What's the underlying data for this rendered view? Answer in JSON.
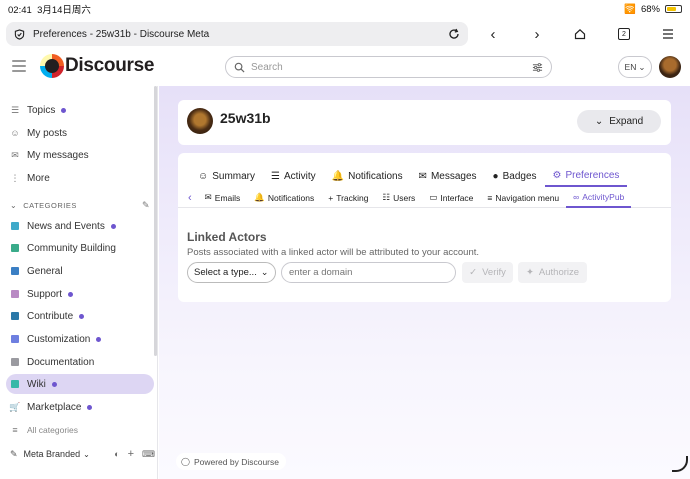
{
  "status": {
    "time": "02:41",
    "date": "3月14日周六",
    "battery": "68%",
    "battery_level": 0.68
  },
  "browser": {
    "tab_title": "Preferences - 25w31b - Discourse Meta",
    "tab_count": "2"
  },
  "header": {
    "logo_text": "Discourse",
    "search_placeholder": "Search",
    "lang": "EN"
  },
  "sidebar": {
    "top_items": [
      {
        "label": "Topics",
        "icon": "layers-icon",
        "dot": true
      },
      {
        "label": "My posts",
        "icon": "user-icon",
        "dot": false
      },
      {
        "label": "My messages",
        "icon": "inbox-icon",
        "dot": false
      },
      {
        "label": "More",
        "icon": "more-icon",
        "dot": false
      }
    ],
    "categories_heading": "CATEGORIES",
    "categories": [
      {
        "label": "News and Events",
        "color": "#3fa9c9",
        "dot": true
      },
      {
        "label": "Community Building",
        "color": "#3aab8a",
        "dot": false
      },
      {
        "label": "General",
        "color": "#3b7fc4",
        "dot": false
      },
      {
        "label": "Support",
        "color": "#b98ac4",
        "dot": true
      },
      {
        "label": "Contribute",
        "color": "#2a78a8",
        "dot": true
      },
      {
        "label": "Customization",
        "color": "#6e7fe0",
        "dot": true
      },
      {
        "label": "Documentation",
        "color": "#9a9aa0",
        "dot": false
      },
      {
        "label": "Wiki",
        "color": "#36b8a8",
        "dot": true,
        "active": true
      },
      {
        "label": "Marketplace",
        "color": "#555555",
        "dot": true
      }
    ],
    "all_categories": "All categories",
    "theme_selector": "Meta Branded"
  },
  "profile": {
    "username": "25w31b",
    "expand_label": "Expand"
  },
  "tabs": [
    {
      "label": "Summary",
      "icon": "user-icon"
    },
    {
      "label": "Activity",
      "icon": "list-icon"
    },
    {
      "label": "Notifications",
      "icon": "bell-icon"
    },
    {
      "label": "Messages",
      "icon": "envelope-icon"
    },
    {
      "label": "Badges",
      "icon": "badge-icon"
    },
    {
      "label": "Preferences",
      "icon": "gear-icon",
      "active": true
    }
  ],
  "subtabs": [
    {
      "label": "Emails",
      "icon": "envelope-icon"
    },
    {
      "label": "Notifications",
      "icon": "bell-icon"
    },
    {
      "label": "Tracking",
      "icon": "plus-icon"
    },
    {
      "label": "Users",
      "icon": "users-icon"
    },
    {
      "label": "Interface",
      "icon": "desktop-icon"
    },
    {
      "label": "Navigation menu",
      "icon": "menu-icon"
    },
    {
      "label": "ActivityPub",
      "icon": "activitypub-icon",
      "active": true
    }
  ],
  "linked_actors": {
    "title": "Linked Actors",
    "description": "Posts associated with a linked actor will be attributed to your account.",
    "select_label": "Select a type...",
    "domain_placeholder": "enter a domain",
    "verify_label": "Verify",
    "authorize_label": "Authorize"
  },
  "footer": {
    "powered_by": "Powered by Discourse"
  },
  "colors": {
    "accent": "#6e56cf",
    "active_bg": "#ddd6f3"
  }
}
